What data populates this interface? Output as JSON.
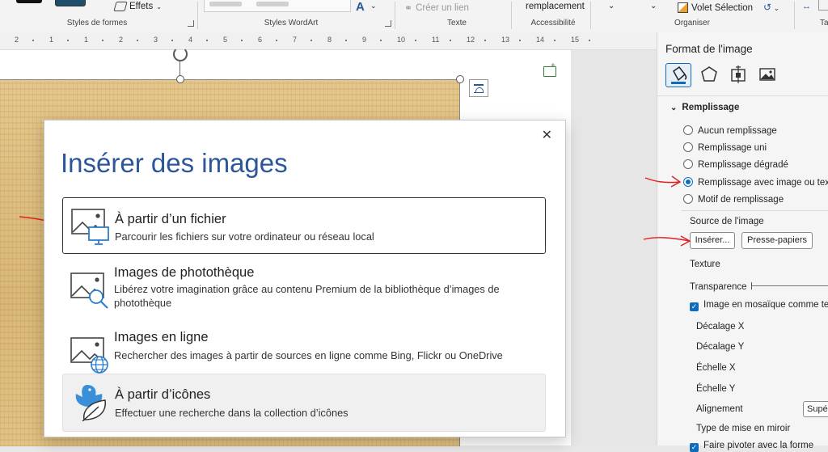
{
  "ribbon": {
    "effets": "Effets",
    "styles_formes": "Styles de formes",
    "styles_wordart": "Styles WordArt",
    "creer_lien": "Créer un lien",
    "texte": "Texte",
    "remplacement": "remplacement",
    "accessibilite": "Accessibilité",
    "volet_selection": "Volet Sélection",
    "organiser": "Organiser",
    "cut_letter": "Ta"
  },
  "ruler": {
    "ticks": [
      "2",
      "1",
      "1",
      "2",
      "3",
      "4",
      "5",
      "6",
      "7",
      "8",
      "9",
      "10",
      "11",
      "12",
      "13",
      "14",
      "15"
    ]
  },
  "dialog": {
    "title": "Insérer des images",
    "close": "✕",
    "options": [
      {
        "title": "À partir d’un fichier",
        "desc": "Parcourir les fichiers sur votre ordinateur ou réseau local"
      },
      {
        "title": "Images de photothèque",
        "desc": "Libérez votre imagination grâce au contenu Premium de la bibliothèque d’images de photothèque"
      },
      {
        "title": "Images en ligne",
        "desc": "Rechercher des images à partir de sources en ligne comme Bing, Flickr ou OneDrive"
      },
      {
        "title": "À partir d’icônes",
        "desc": "Effectuer une recherche dans la collection d’icônes"
      }
    ]
  },
  "pane": {
    "title": "Format de l'image",
    "section": "Remplissage",
    "radios": [
      {
        "label": "Aucun remplissage",
        "selected": false
      },
      {
        "label": "Remplissage uni",
        "selected": false
      },
      {
        "label": "Remplissage dégradé",
        "selected": false
      },
      {
        "label": "Remplissage avec image ou texture",
        "selected": true
      },
      {
        "label": "Motif de remplissage",
        "selected": false
      }
    ],
    "source": "Source de l'image",
    "insert_btn": "Insérer...",
    "clipboard_btn": "Presse-papiers",
    "texture": "Texture",
    "transparence": "Transparence",
    "mosaique": "Image en mosaïque comme texture",
    "decalage_x": "Décalage X",
    "decalage_y": "Décalage Y",
    "echelle_x": "Échelle X",
    "echelle_y": "Échelle Y",
    "alignement": "Alignement",
    "alignement_value": "Supé",
    "miroir": "Type de mise en miroir",
    "pivoter": "Faire pivoter avec la forme"
  },
  "colors": {
    "accent": "#0f6cbd",
    "title_blue": "#2b579a",
    "annotation_red": "#e02020"
  }
}
